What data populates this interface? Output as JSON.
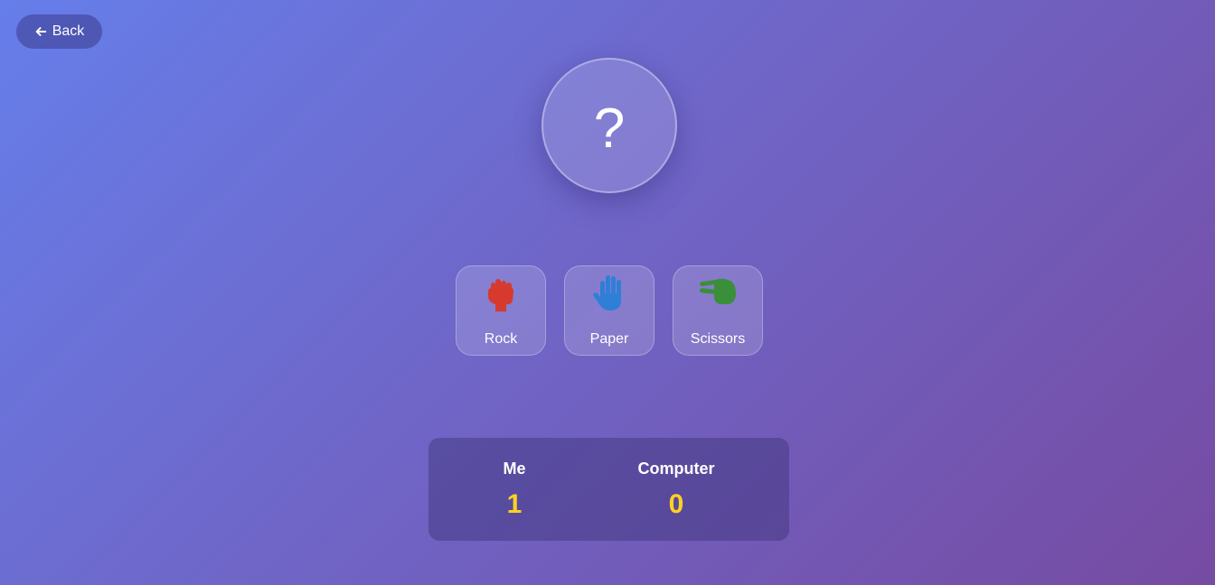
{
  "header": {
    "back_label": "Back",
    "back_icon": "arrow-left-icon"
  },
  "computer_choice": {
    "display": "?"
  },
  "choices": [
    {
      "label": "Rock",
      "icon": "rock-fist-icon",
      "color": "#d63a2f"
    },
    {
      "label": "Paper",
      "icon": "paper-hand-icon",
      "color": "#2f7fd6"
    },
    {
      "label": "Scissors",
      "icon": "scissors-hand-icon",
      "color": "#3a8f3a"
    }
  ],
  "scoreboard": {
    "me_label": "Me",
    "me_score": "1",
    "computer_label": "Computer",
    "computer_score": "0",
    "score_color": "#ffd21f"
  }
}
